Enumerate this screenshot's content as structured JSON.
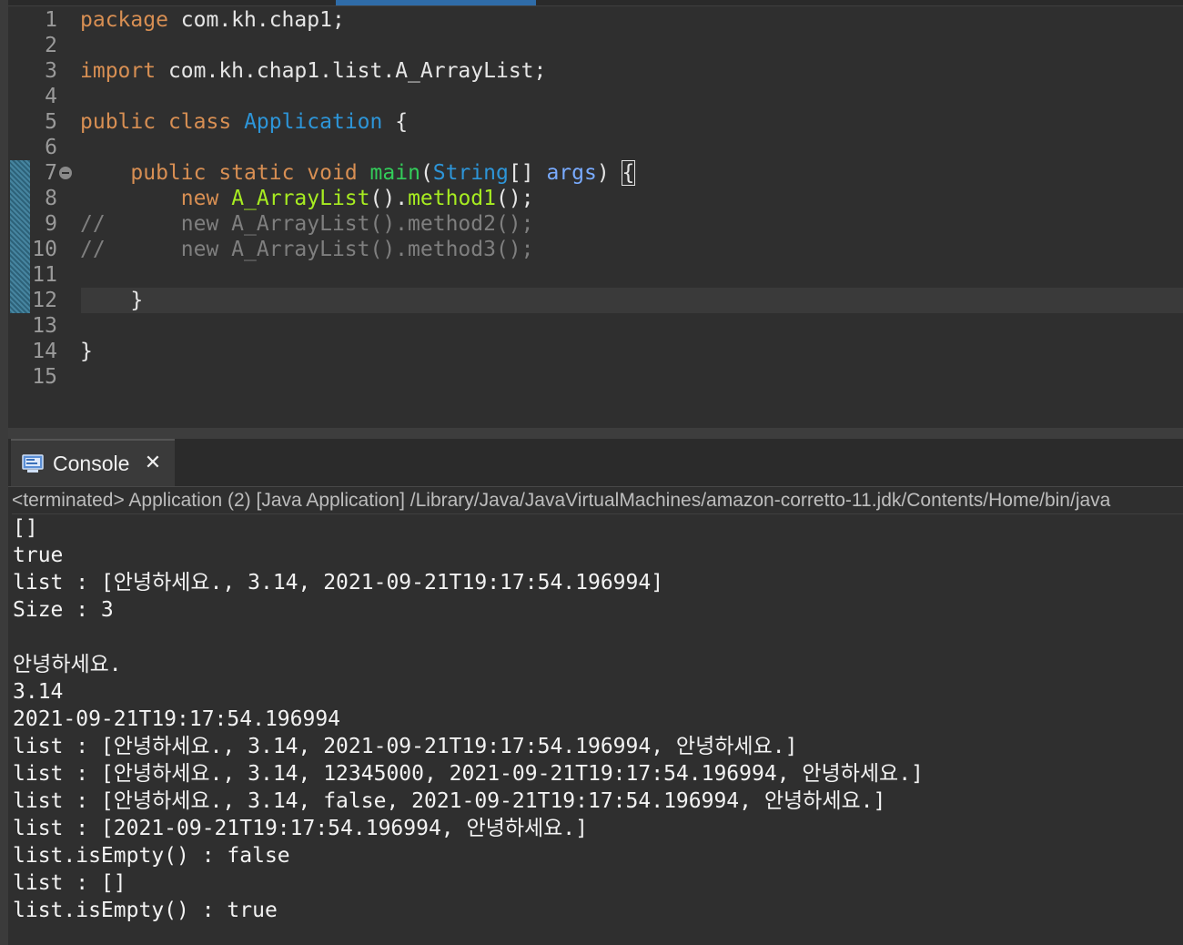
{
  "editor": {
    "lines": [
      {
        "num": "1",
        "tokens": [
          {
            "t": "package",
            "c": "kw"
          },
          {
            "t": " com.kh.chap1;",
            "c": "plain"
          }
        ]
      },
      {
        "num": "2",
        "tokens": []
      },
      {
        "num": "3",
        "tokens": [
          {
            "t": "import",
            "c": "kw"
          },
          {
            "t": " com.kh.chap1.list.A_ArrayList;",
            "c": "plain"
          }
        ]
      },
      {
        "num": "4",
        "tokens": []
      },
      {
        "num": "5",
        "tokens": [
          {
            "t": "public",
            "c": "kw"
          },
          {
            "t": " ",
            "c": "plain"
          },
          {
            "t": "class",
            "c": "kw"
          },
          {
            "t": " ",
            "c": "plain"
          },
          {
            "t": "Application",
            "c": "type"
          },
          {
            "t": " {",
            "c": "plain"
          }
        ]
      },
      {
        "num": "6",
        "tokens": []
      },
      {
        "num": "7",
        "fold": true,
        "tokens": [
          {
            "t": "    ",
            "c": "plain"
          },
          {
            "t": "public",
            "c": "kw"
          },
          {
            "t": " ",
            "c": "plain"
          },
          {
            "t": "static",
            "c": "kw"
          },
          {
            "t": " ",
            "c": "plain"
          },
          {
            "t": "void",
            "c": "kw"
          },
          {
            "t": " ",
            "c": "plain"
          },
          {
            "t": "main",
            "c": "method"
          },
          {
            "t": "(",
            "c": "plain"
          },
          {
            "t": "String",
            "c": "type"
          },
          {
            "t": "[] ",
            "c": "plain"
          },
          {
            "t": "args",
            "c": "param"
          },
          {
            "t": ") ",
            "c": "plain"
          },
          {
            "t": "{",
            "c": "plain cursor-box"
          }
        ]
      },
      {
        "num": "8",
        "tokens": [
          {
            "t": "        ",
            "c": "plain"
          },
          {
            "t": "new",
            "c": "kw"
          },
          {
            "t": " ",
            "c": "plain"
          },
          {
            "t": "A_ArrayList",
            "c": "ctor"
          },
          {
            "t": "().",
            "c": "plain"
          },
          {
            "t": "method1",
            "c": "ctor"
          },
          {
            "t": "();",
            "c": "plain"
          }
        ]
      },
      {
        "num": "9",
        "tokens": [
          {
            "t": "//      new A_ArrayList().method2();",
            "c": "comment"
          }
        ]
      },
      {
        "num": "10",
        "tokens": [
          {
            "t": "//      new A_ArrayList().method3();",
            "c": "comment"
          }
        ]
      },
      {
        "num": "11",
        "tokens": []
      },
      {
        "num": "12",
        "tokens": [
          {
            "t": "    }",
            "c": "plain"
          }
        ]
      },
      {
        "num": "13",
        "tokens": []
      },
      {
        "num": "14",
        "tokens": [
          {
            "t": "}",
            "c": "plain"
          }
        ]
      },
      {
        "num": "15",
        "tokens": []
      }
    ]
  },
  "console": {
    "tab_label": "Console",
    "status": "<terminated> Application (2) [Java Application] /Library/Java/JavaVirtualMachines/amazon-corretto-11.jdk/Contents/Home/bin/java",
    "output": [
      "[]",
      "true",
      "list : [안녕하세요., 3.14, 2021-09-21T19:17:54.196994]",
      "Size : 3",
      "",
      "안녕하세요.",
      "3.14",
      "2021-09-21T19:17:54.196994",
      "list : [안녕하세요., 3.14, 2021-09-21T19:17:54.196994, 안녕하세요.]",
      "list : [안녕하세요., 3.14, 12345000, 2021-09-21T19:17:54.196994, 안녕하세요.]",
      "list : [안녕하세요., 3.14, false, 2021-09-21T19:17:54.196994, 안녕하세요.]",
      "list : [2021-09-21T19:17:54.196994, 안녕하세요.]",
      "list.isEmpty() : false",
      "list : []",
      "list.isEmpty() : true"
    ]
  },
  "colors": {
    "keyword": "#d88f53",
    "type": "#2d95d8",
    "method": "#33cc5a",
    "param": "#79abff",
    "constructor": "#a7ec21",
    "comment": "#7f7f7f",
    "background": "#2f2f2f"
  },
  "icons": {
    "console_tab": "console-monitor-icon",
    "close": "close-icon",
    "fold": "fold-collapse-icon"
  }
}
